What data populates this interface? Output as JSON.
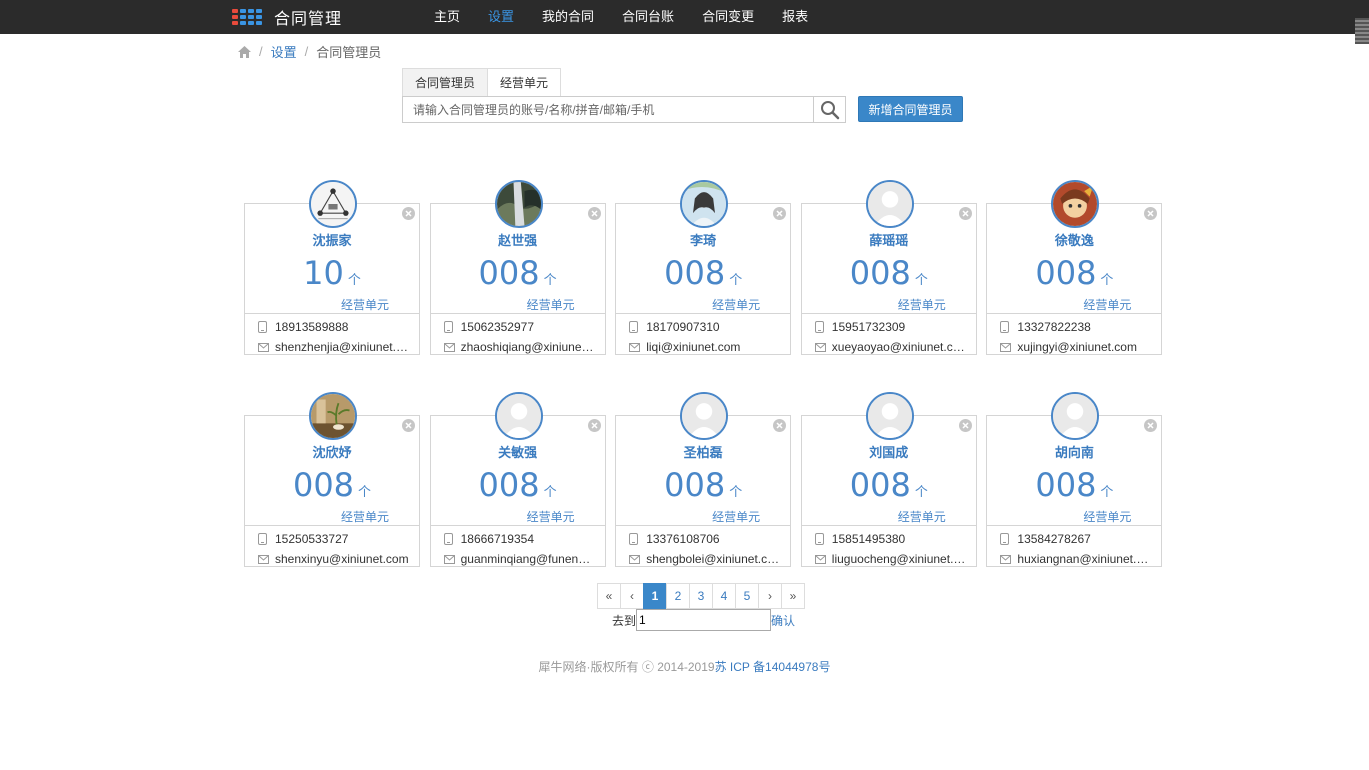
{
  "header": {
    "app_title": "合同管理",
    "nav": [
      {
        "label": "主页",
        "active": false
      },
      {
        "label": "设置",
        "active": true
      },
      {
        "label": "我的合同",
        "active": false
      },
      {
        "label": "合同台账",
        "active": false
      },
      {
        "label": "合同变更",
        "active": false
      },
      {
        "label": "报表",
        "active": false
      }
    ]
  },
  "breadcrumb": {
    "level1": "设置",
    "level2": "合同管理员"
  },
  "tabs": [
    {
      "label": "合同管理员",
      "active": true
    },
    {
      "label": "经营单元",
      "active": false
    }
  ],
  "search": {
    "placeholder": "请输入合同管理员的账号/名称/拼音/邮箱/手机",
    "value": ""
  },
  "add_button": "新增合同管理员",
  "card_unit_label": "经营单元",
  "count_unit": "个",
  "cards": [
    {
      "name": "沈振家",
      "count": "10",
      "phone": "18913589888",
      "email": "shenzhenjia@xiniunet.com",
      "avatar": "diagram"
    },
    {
      "name": "赵世强",
      "count": "008",
      "phone": "15062352977",
      "email": "zhaoshiqiang@xiniunet.com",
      "avatar": "waterfall"
    },
    {
      "name": "李琦",
      "count": "008",
      "phone": "18170907310",
      "email": "liqi@xiniunet.com",
      "avatar": "portrait"
    },
    {
      "name": "薛瑶瑶",
      "count": "008",
      "phone": "15951732309",
      "email": "xueyaoyao@xiniunet.com",
      "avatar": "default"
    },
    {
      "name": "徐敬逸",
      "count": "008",
      "phone": "13327822238",
      "email": "xujingyi@xiniunet.com",
      "avatar": "cartoon"
    },
    {
      "name": "沈欣妤",
      "count": "008",
      "phone": "15250533727",
      "email": "shenxinyu@xiniunet.com",
      "avatar": "plant"
    },
    {
      "name": "关敏强",
      "count": "008",
      "phone": "18666719354",
      "email": "guanminqiang@funeng.com",
      "avatar": "default"
    },
    {
      "name": "圣柏磊",
      "count": "008",
      "phone": "13376108706",
      "email": "shengbolei@xiniunet.com",
      "avatar": "default"
    },
    {
      "name": "刘国成",
      "count": "008",
      "phone": "15851495380",
      "email": "liuguocheng@xiniunet.com",
      "avatar": "default"
    },
    {
      "name": "胡向南",
      "count": "008",
      "phone": "13584278267",
      "email": "huxiangnan@xiniunet.com",
      "avatar": "default"
    }
  ],
  "pagination": {
    "first": "«",
    "prev": "‹",
    "pages": [
      "1",
      "2",
      "3",
      "4",
      "5"
    ],
    "current": "1",
    "next": "›",
    "last": "»",
    "goto_label": "去到",
    "goto_value": "1",
    "confirm": "确认"
  },
  "footer": {
    "copyright": "犀牛网络·版权所有 ⓒ 2014-2019",
    "icp": "苏 ICP 备14044978号"
  },
  "colors": {
    "topbar": "#2b2b2b",
    "accent": "#3a87c9",
    "nav_active": "#3a95e4",
    "logo_dots": [
      "#e94b3c",
      "#3a95e4",
      "#3a95e4",
      "#3a95e4"
    ]
  }
}
